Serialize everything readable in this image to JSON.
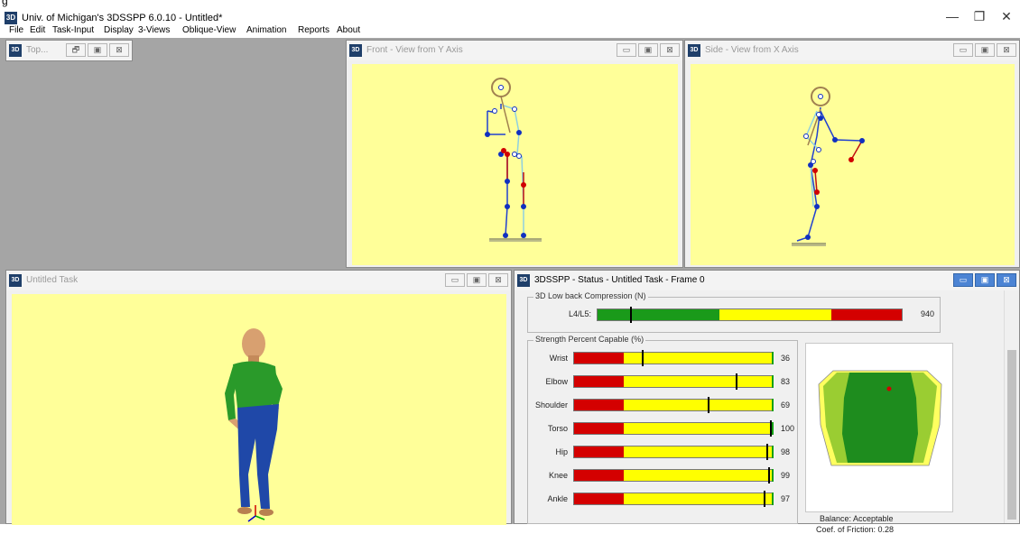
{
  "app": {
    "cut_top_text": "g",
    "logo": "3D",
    "title": "Univ. of Michigan's 3DSSPP 6.0.10 - Untitled*",
    "controls": {
      "minimize": "—",
      "restore": "❐",
      "close": "✕"
    }
  },
  "menu": [
    "File",
    "Edit",
    "Task-Input",
    "Display",
    "3-Views",
    "Oblique-View",
    "Animation",
    "Reports",
    "About"
  ],
  "windows": {
    "top": {
      "title": "Top...",
      "icon": "3D"
    },
    "front": {
      "title": "Front - View from Y Axis",
      "icon": "3D"
    },
    "side": {
      "title": "Side - View from X Axis",
      "icon": "3D"
    },
    "task": {
      "title": "Untitled Task",
      "icon": "3D"
    },
    "status": {
      "title": "3DSSPP - Status - Untitled Task - Frame 0",
      "icon": "3D"
    }
  },
  "mdi_buttons": {
    "minimize": "▭",
    "maximize": "▣",
    "close": "⊠",
    "restore": "🗗"
  },
  "low_back": {
    "legend": "3D Low back Compression (N)",
    "label": "L4/L5:",
    "value": "940",
    "fraction": 0.11
  },
  "strength": {
    "legend": "Strength Percent Capable (%)",
    "rows": [
      {
        "label": "Wrist",
        "value": "36",
        "pct": 36
      },
      {
        "label": "Elbow",
        "value": "83",
        "pct": 83
      },
      {
        "label": "Shoulder",
        "value": "69",
        "pct": 69
      },
      {
        "label": "Torso",
        "value": "100",
        "pct": 100
      },
      {
        "label": "Hip",
        "value": "98",
        "pct": 98
      },
      {
        "label": "Knee",
        "value": "99",
        "pct": 99
      },
      {
        "label": "Ankle",
        "value": "97",
        "pct": 97
      }
    ]
  },
  "balance": {
    "status": "Balance: Acceptable",
    "friction": "Coef. of Friction:  0.28"
  },
  "colors": {
    "yellow_view": "#ffff99",
    "bar_red": "#d40000",
    "bar_yellow": "#ffff00",
    "bar_green": "#1a9a1a",
    "mdi_bg": "#a5a5a5"
  }
}
